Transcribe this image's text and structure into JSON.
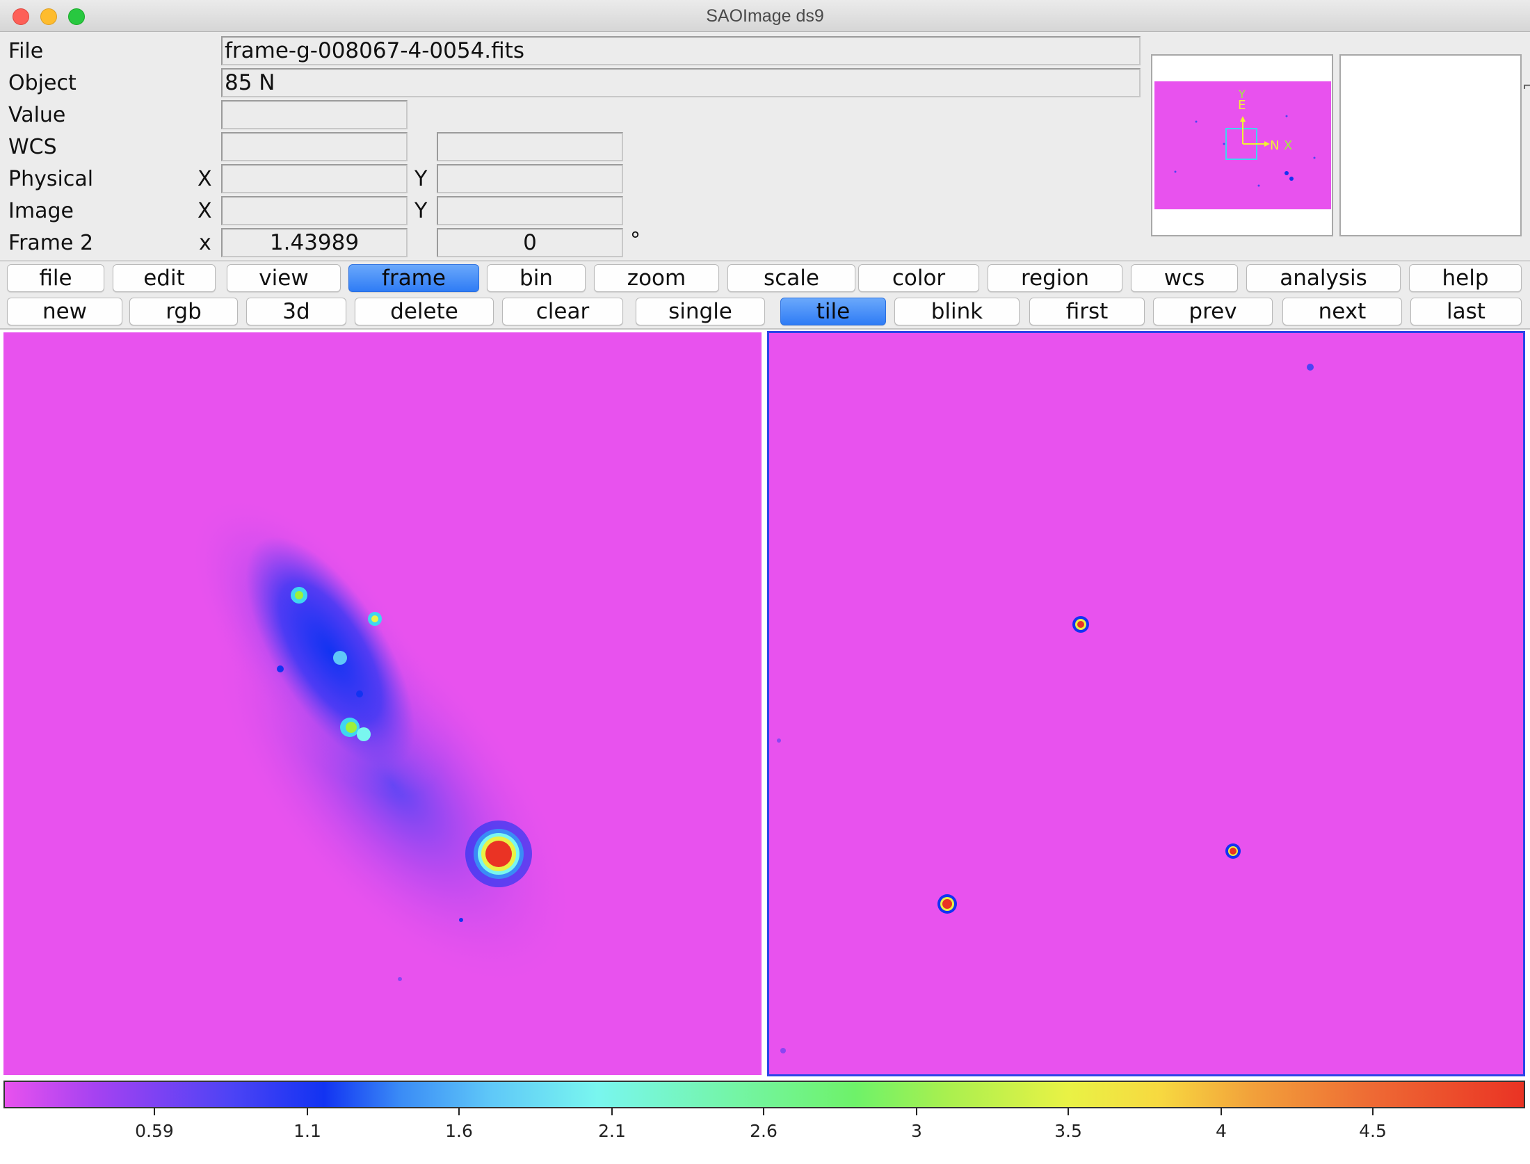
{
  "window": {
    "title": "SAOImage ds9"
  },
  "info": {
    "file_label": "File",
    "file_value": "frame-g-008067-4-0054.fits",
    "object_label": "Object",
    "object_value": "85 N",
    "value_label": "Value",
    "value_value": "",
    "wcs_label": "WCS",
    "wcs_value1": "",
    "wcs_value2": "",
    "physical_label": "Physical",
    "physical_x_label": "X",
    "physical_y_label": "Y",
    "physical_x": "",
    "physical_y": "",
    "image_label": "Image",
    "image_x_label": "X",
    "image_y_label": "Y",
    "image_x": "",
    "image_y": "",
    "frame_label": "Frame 2",
    "frame_x_label": "x",
    "frame_zoom": "1.43989",
    "frame_angle": "0",
    "frame_angle_unit": "°"
  },
  "panner": {
    "compass_n": "N",
    "compass_e": "E",
    "axis_x": "X",
    "axis_y": "Y",
    "colors": {
      "background": "#e852ee",
      "compass": "#f2f233",
      "axes": "#9ef03a",
      "box": "#3fd6f0"
    }
  },
  "menubar": [
    {
      "label": "file",
      "active": false
    },
    {
      "label": "edit",
      "active": false
    },
    {
      "label": "view",
      "active": false
    },
    {
      "label": "frame",
      "active": true
    },
    {
      "label": "bin",
      "active": false
    },
    {
      "label": "zoom",
      "active": false
    },
    {
      "label": "scale",
      "active": false
    },
    {
      "label": "color",
      "active": false
    },
    {
      "label": "region",
      "active": false
    },
    {
      "label": "wcs",
      "active": false
    },
    {
      "label": "analysis",
      "active": false
    },
    {
      "label": "help",
      "active": false
    }
  ],
  "buttonbar": [
    {
      "label": "new",
      "active": false
    },
    {
      "label": "rgb",
      "active": false
    },
    {
      "label": "3d",
      "active": false
    },
    {
      "label": "delete",
      "active": false
    },
    {
      "label": "clear",
      "active": false
    },
    {
      "label": "single",
      "active": false
    },
    {
      "label": "tile",
      "active": true
    },
    {
      "label": "blink",
      "active": false
    },
    {
      "label": "first",
      "active": false
    },
    {
      "label": "prev",
      "active": false
    },
    {
      "label": "next",
      "active": false
    },
    {
      "label": "last",
      "active": false
    }
  ],
  "colorbar": {
    "ticks": [
      "0.59",
      "1.1",
      "1.6",
      "2.1",
      "2.6",
      "3",
      "3.5",
      "4",
      "4.5"
    ],
    "colors": {
      "low": "#e852ee",
      "high": "#ea3324"
    }
  },
  "frames": {
    "active_frame": "Frame 2",
    "colors": {
      "background": "#e852ee",
      "active_border": "#2b44e8"
    }
  }
}
